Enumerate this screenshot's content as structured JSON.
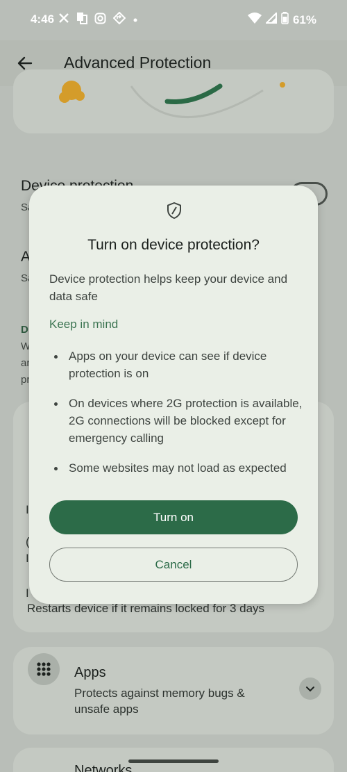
{
  "status_bar": {
    "time": "4:46",
    "battery": "61%",
    "left_icons": [
      "x-icon",
      "notification-icon",
      "instagram-icon",
      "maps-icon",
      "dot-icon"
    ],
    "right_icons": [
      "wifi-icon",
      "signal-icon",
      "battery-icon"
    ]
  },
  "app_bar": {
    "title": "Advanced Protection",
    "back_icon": "arrow-left-icon"
  },
  "background": {
    "device_protection_heading": "Device protection",
    "device_protection_sub": "Sa",
    "second_heading": "A",
    "second_sub": "Sa",
    "section_label": "D",
    "section_text_lines": [
      "W",
      "ar",
      "pr"
    ],
    "card_partial_lines": [
      "I",
      "(",
      "I"
    ],
    "restart_partial_label": "I",
    "restart_text": "Restarts device if it remains locked for 3 days",
    "apps_title": "Apps",
    "apps_desc": "Protects against memory bugs & unsafe apps",
    "networks_title": "Networks"
  },
  "dialog": {
    "icon": "shield-icon",
    "title": "Turn on device protection?",
    "body": "Device protection helps keep your device and data safe",
    "keep_in_mind": "Keep in mind",
    "bullets": [
      "Apps on your device can see if device protection is on",
      "On devices where 2G protection is available, 2G connections will be blocked except for emergency calling",
      "Some websites may not load as expected"
    ],
    "turn_on_label": "Turn on",
    "cancel_label": "Cancel"
  },
  "colors": {
    "scrim_background": "#b9beb8",
    "dialog_surface": "#eaefe7",
    "primary": "#2c6b48",
    "accent_text": "#3a7350"
  }
}
